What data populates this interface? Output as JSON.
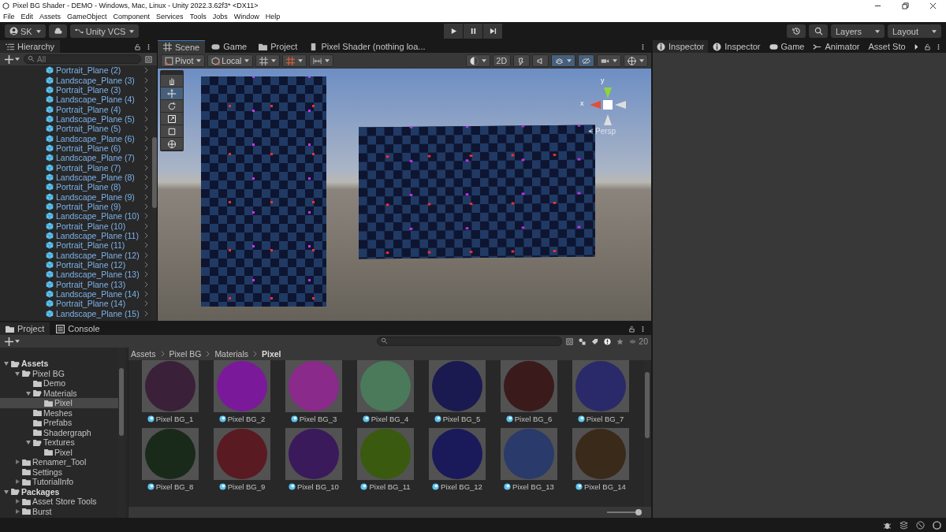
{
  "window": {
    "title": "Pixel BG Shader - DEMO - Windows, Mac, Linux - Unity 2022.3.62f3* <DX11>"
  },
  "menu": [
    "File",
    "Edit",
    "Assets",
    "GameObject",
    "Component",
    "Services",
    "Tools",
    "Jobs",
    "Window",
    "Help"
  ],
  "toolbar": {
    "account": "SK",
    "vcs": "Unity VCS",
    "layers": "Layers",
    "layout": "Layout"
  },
  "hierarchy": {
    "title": "Hierarchy",
    "search": {
      "placeholder": "All"
    },
    "items": [
      {
        "label": "Portrait_Plane (2)"
      },
      {
        "label": "Landscape_Plane (3)"
      },
      {
        "label": "Portrait_Plane (3)"
      },
      {
        "label": "Landscape_Plane (4)"
      },
      {
        "label": "Portrait_Plane (4)"
      },
      {
        "label": "Landscape_Plane (5)"
      },
      {
        "label": "Portrait_Plane (5)"
      },
      {
        "label": "Landscape_Plane (6)"
      },
      {
        "label": "Portrait_Plane (6)"
      },
      {
        "label": "Landscape_Plane (7)"
      },
      {
        "label": "Portrait_Plane (7)"
      },
      {
        "label": "Landscape_Plane (8)"
      },
      {
        "label": "Portrait_Plane (8)"
      },
      {
        "label": "Landscape_Plane (9)"
      },
      {
        "label": "Portrait_Plane (9)"
      },
      {
        "label": "Landscape_Plane (10)"
      },
      {
        "label": "Portrait_Plane (10)"
      },
      {
        "label": "Landscape_Plane (11)"
      },
      {
        "label": "Portrait_Plane (11)"
      },
      {
        "label": "Landscape_Plane (12)"
      },
      {
        "label": "Portrait_Plane (12)"
      },
      {
        "label": "Landscape_Plane (13)"
      },
      {
        "label": "Portrait_Plane (13)"
      },
      {
        "label": "Landscape_Plane (14)"
      },
      {
        "label": "Portrait_Plane (14)"
      },
      {
        "label": "Landscape_Plane (15)"
      }
    ]
  },
  "center_tabs": [
    {
      "label": "Scene",
      "kind": "scene",
      "selected": true
    },
    {
      "label": "Game",
      "kind": "game",
      "selected": false
    },
    {
      "label": "Project",
      "kind": "project",
      "selected": false
    },
    {
      "label": "Pixel Shader (nothing loa...",
      "kind": "shader",
      "selected": false
    }
  ],
  "scene": {
    "pivot": "Pivot",
    "space": "Local",
    "mode_2d": {
      "label": "2D",
      "on": false
    },
    "toggles": [
      {
        "kind": "lighting",
        "on": false
      },
      {
        "kind": "audio",
        "on": false
      },
      {
        "kind": "effects",
        "on": true
      },
      {
        "kind": "visibility",
        "on": true
      }
    ],
    "tools": [
      {
        "kind": "hand",
        "selected": false
      },
      {
        "kind": "move",
        "selected": true
      },
      {
        "kind": "rotate",
        "selected": false
      },
      {
        "kind": "scale",
        "selected": false
      },
      {
        "kind": "rect",
        "selected": false
      },
      {
        "kind": "transform",
        "selected": false
      }
    ],
    "gizmo": {
      "x_label": "x",
      "y_label": "y",
      "projection": "Persp"
    }
  },
  "inspector_tabs": [
    {
      "label": "Inspector",
      "kind": "info",
      "selected": true
    },
    {
      "label": "Inspector",
      "kind": "info",
      "selected": false
    },
    {
      "label": "Game",
      "kind": "game",
      "selected": false
    },
    {
      "label": "Animator",
      "kind": "animator",
      "selected": false
    },
    {
      "label": "Asset Sto",
      "kind": "plain",
      "selected": false
    }
  ],
  "bottom_tabs": [
    {
      "label": "Project",
      "kind": "folder",
      "selected": true
    },
    {
      "label": "Console",
      "kind": "console",
      "selected": false
    }
  ],
  "project": {
    "tree": [
      {
        "label": "Assets",
        "bold": true,
        "expanded": true,
        "selected": false,
        "children": [
          {
            "label": "Pixel BG",
            "bold": false,
            "expanded": true,
            "selected": false,
            "children": [
              {
                "label": "Demo",
                "bold": false,
                "selected": false
              },
              {
                "label": "Materials",
                "bold": false,
                "expanded": true,
                "selected": false,
                "children": [
                  {
                    "label": "Pixel",
                    "bold": false,
                    "selected": true
                  }
                ]
              },
              {
                "label": "Meshes",
                "bold": false,
                "selected": false
              },
              {
                "label": "Prefabs",
                "bold": false,
                "selected": false
              },
              {
                "label": "Shadergraph",
                "bold": false,
                "selected": false
              },
              {
                "label": "Textures",
                "bold": false,
                "expanded": true,
                "selected": false,
                "children": [
                  {
                    "label": "Pixel",
                    "bold": false,
                    "selected": false
                  }
                ]
              }
            ]
          },
          {
            "label": "Renamer_Tool",
            "bold": false,
            "expanded": false,
            "selected": false
          },
          {
            "label": "Settings",
            "bold": false,
            "selected": false
          },
          {
            "label": "TutorialInfo",
            "bold": false,
            "expanded": false,
            "selected": false
          }
        ]
      },
      {
        "label": "Packages",
        "bold": true,
        "expanded": true,
        "selected": false,
        "children": [
          {
            "label": "Asset Store Tools",
            "bold": false,
            "expanded": false,
            "selected": false
          },
          {
            "label": "Burst",
            "bold": false,
            "expanded": false,
            "selected": false
          }
        ]
      }
    ],
    "breadcrumb": [
      "Assets",
      "Pixel BG",
      "Materials",
      "Pixel"
    ],
    "hidden_count": "20",
    "materials": [
      {
        "name": "Pixel BG_1",
        "color": "#3a2038"
      },
      {
        "name": "Pixel BG_2",
        "color": "#7a1a9a"
      },
      {
        "name": "Pixel BG_3",
        "color": "#8a2a8a"
      },
      {
        "name": "Pixel BG_4",
        "color": "#4a7a5a"
      },
      {
        "name": "Pixel BG_5",
        "color": "#1a1a50"
      },
      {
        "name": "Pixel BG_6",
        "color": "#3a1a1a"
      },
      {
        "name": "Pixel BG_7",
        "color": "#2a2a6a"
      },
      {
        "name": "Pixel BG_8",
        "color": "#1a2a1a"
      },
      {
        "name": "Pixel BG_9",
        "color": "#5a1a22"
      },
      {
        "name": "Pixel BG_10",
        "color": "#3a1a5a"
      },
      {
        "name": "Pixel BG_11",
        "color": "#3a5a10"
      },
      {
        "name": "Pixel BG_12",
        "color": "#1a1a5a"
      },
      {
        "name": "Pixel BG_13",
        "color": "#2a3a6a"
      },
      {
        "name": "Pixel BG_14",
        "color": "#3a2a1a"
      }
    ],
    "zoom": {
      "level": 1
    }
  }
}
